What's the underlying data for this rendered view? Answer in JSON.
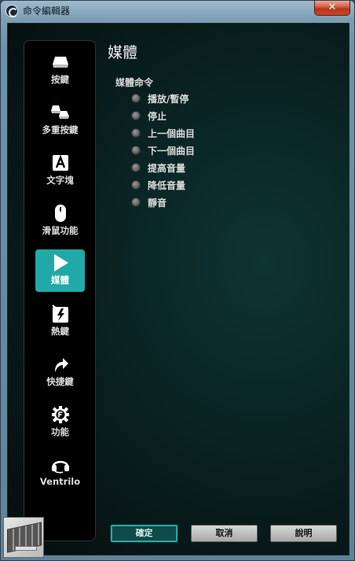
{
  "window": {
    "title": "命令編輯器",
    "close_label": "✕"
  },
  "sidebar": {
    "items": [
      {
        "label": "按鍵",
        "icon": "key-icon",
        "active": false
      },
      {
        "label": "多重按鍵",
        "icon": "multi-key-icon",
        "active": false
      },
      {
        "label": "文字塊",
        "icon": "text-block-icon",
        "active": false
      },
      {
        "label": "滑鼠功能",
        "icon": "mouse-icon",
        "active": false
      },
      {
        "label": "媒體",
        "icon": "play-icon",
        "active": true
      },
      {
        "label": "熱鍵",
        "icon": "hotkey-icon",
        "active": false
      },
      {
        "label": "快捷鍵",
        "icon": "shortcut-arrow-icon",
        "active": false
      },
      {
        "label": "功能",
        "icon": "function-gear-icon",
        "active": false
      },
      {
        "label": "Ventrilo",
        "icon": "headset-icon",
        "active": false
      }
    ],
    "active_color": "#21a9a7"
  },
  "main": {
    "title": "媒體",
    "section_label": "媒體命令",
    "options": [
      {
        "label": "播放/暫停",
        "selected": false
      },
      {
        "label": "停止",
        "selected": false
      },
      {
        "label": "上一個曲目",
        "selected": false
      },
      {
        "label": "下一個曲目",
        "selected": false
      },
      {
        "label": "提高音量",
        "selected": false
      },
      {
        "label": "降低音量",
        "selected": false
      },
      {
        "label": "靜音",
        "selected": false
      }
    ]
  },
  "footer": {
    "ok_label": "確定",
    "cancel_label": "取消",
    "help_label": "說明"
  }
}
